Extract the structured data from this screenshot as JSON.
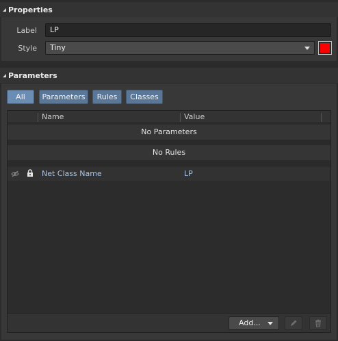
{
  "properties": {
    "title": "Properties",
    "label_caption": "Label",
    "label_value": "LP",
    "style_caption": "Style",
    "style_value": "Tiny",
    "color": "#ff0000"
  },
  "parameters": {
    "title": "Parameters",
    "filters": [
      {
        "label": "All",
        "active": true
      },
      {
        "label": "Parameters",
        "active": false
      },
      {
        "label": "Rules",
        "active": false
      },
      {
        "label": "Classes",
        "active": false
      }
    ],
    "columns": {
      "name": "Name",
      "value": "Value"
    },
    "group_parameters": "No Parameters",
    "group_rules": "No Rules",
    "rows": [
      {
        "name": "Net Class Name",
        "value": "LP"
      }
    ],
    "add_label": "Add..."
  }
}
